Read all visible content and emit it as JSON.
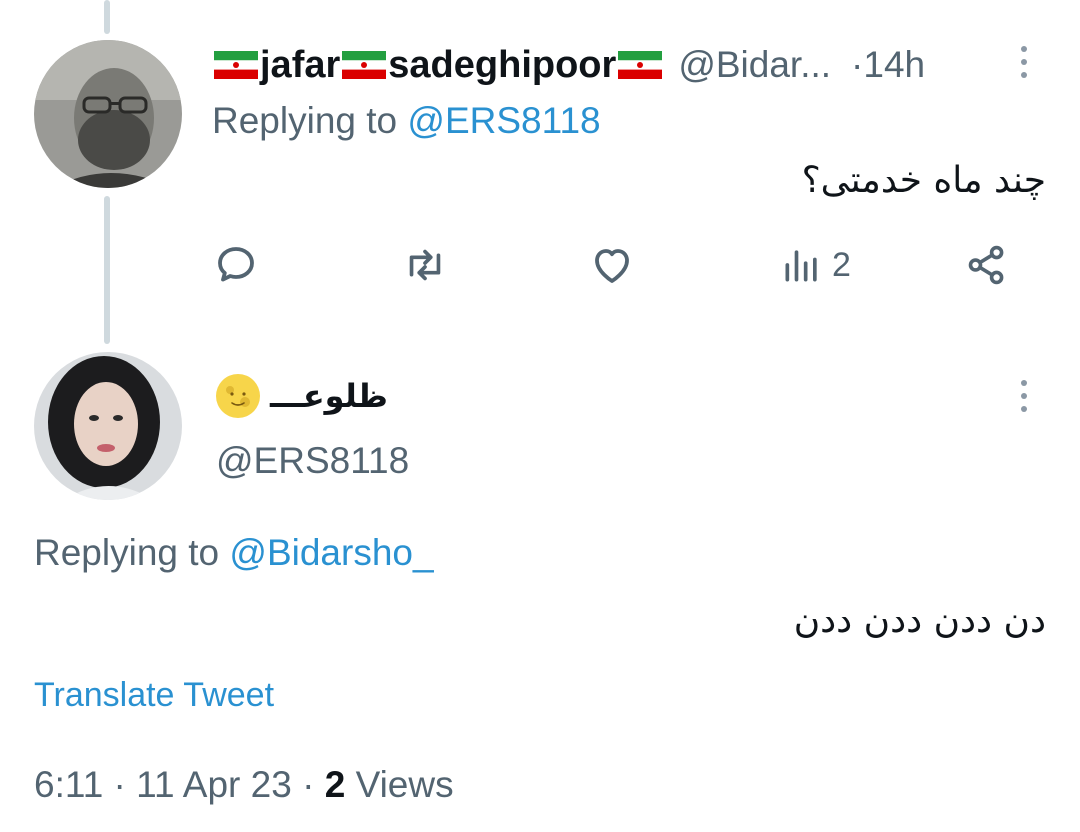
{
  "reply_tweet": {
    "name_parts": [
      "jafar",
      "sadeghipoor"
    ],
    "handle_truncated": "@Bidar...",
    "separator": "·",
    "time": "14h",
    "replying_prefix": "Replying to",
    "replying_mention": "@ERS8118",
    "body_text": "چند ماه خدمتی؟",
    "views_count": "2",
    "icons": {
      "flag": "iran-flag-icon",
      "reply": "reply-icon",
      "retweet": "retweet-icon",
      "like": "heart-icon",
      "views": "views-icon",
      "share": "share-icon",
      "more": "more-options-icon"
    }
  },
  "main_tweet": {
    "display_name": "ظلوعـــ",
    "emoji": "moon-face-icon",
    "handle": "@ERS8118",
    "replying_prefix": "Replying to",
    "replying_mention": "@Bidarsho_",
    "body_text": "دن ددن ددن ددن",
    "translate_label": "Translate Tweet",
    "meta": {
      "time_date": "6:11 · 11 Apr 23 ·",
      "views_count": "2",
      "views_label": "Views"
    }
  },
  "colors": {
    "text_primary": "#0f1419",
    "text_secondary": "#536471",
    "link": "#2a91d1",
    "thread_line": "#cfd9de"
  }
}
